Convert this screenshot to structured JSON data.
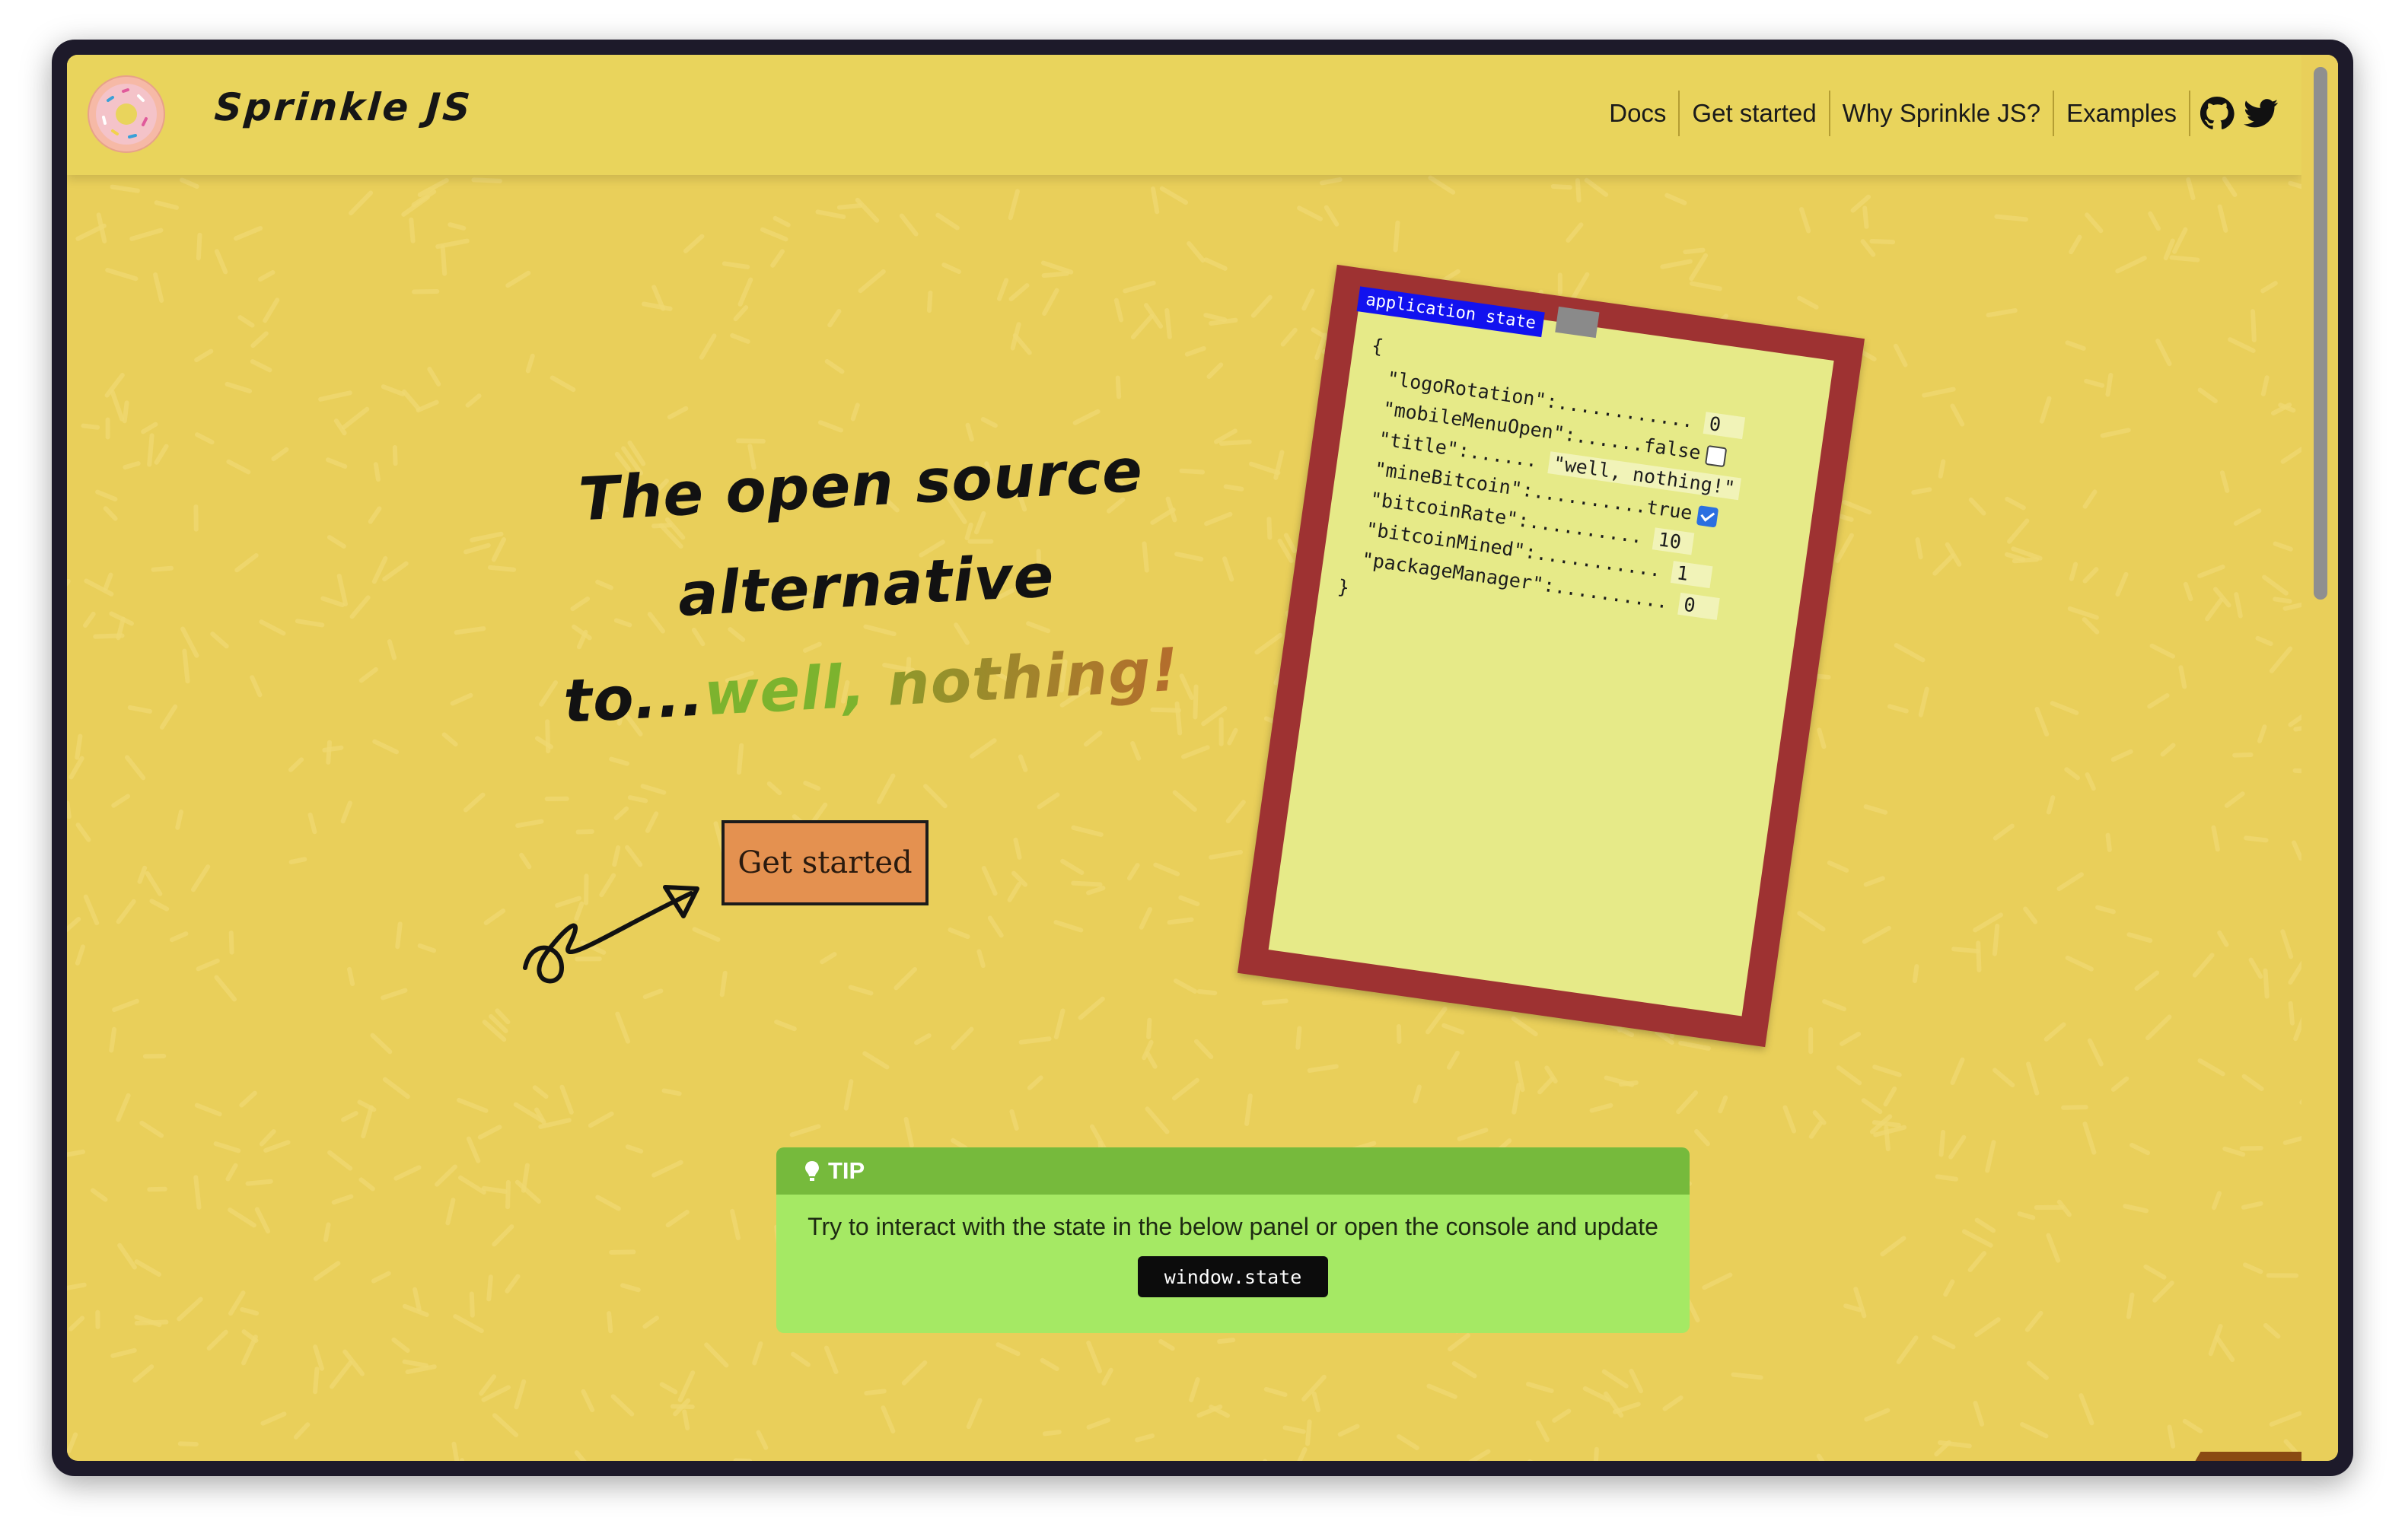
{
  "brand": {
    "name": "Sprinkle JS"
  },
  "nav": {
    "links": [
      "Docs",
      "Get started",
      "Why Sprinkle JS?",
      "Examples"
    ],
    "icons": [
      "github-icon",
      "twitter-icon"
    ]
  },
  "hero": {
    "line1": "The open source",
    "line2": "alternative",
    "line3_prefix": "to...",
    "line3_green": "well,",
    "line3_grad": "nothing!",
    "cta_label": "Get started"
  },
  "state_panel": {
    "tab_label": "application state",
    "open_brace": "{",
    "close_brace": "}",
    "rows": [
      {
        "key": "\"logoRotation\":",
        "dots": "............",
        "value": "0"
      },
      {
        "key": "\"mobileMenuOpen\":",
        "dots": "......",
        "value": "false"
      },
      {
        "key": "\"title\":",
        "dots": "......",
        "value": "\"well, nothing!\""
      },
      {
        "key": "\"mineBitcoin\":",
        "dots": "..........",
        "value": "true"
      },
      {
        "key": "\"bitcoinRate\":",
        "dots": "..........",
        "value": "10"
      },
      {
        "key": "\"bitcoinMined\":",
        "dots": "...........",
        "value": "1"
      },
      {
        "key": "\"packageManager\":",
        "dots": "..........",
        "value": "0"
      }
    ]
  },
  "tip": {
    "title": "TIP",
    "text": "Try to interact with the state in the below panel or open the console and update",
    "code": "window.state"
  },
  "colors": {
    "background": "#e9cf5a",
    "navbar": "#e9d45c",
    "cta": "#e49150",
    "clipboard": "#9e3232",
    "paper": "#e6ea88",
    "tip_header": "#76ba3c",
    "tip_body": "#a5e964"
  }
}
